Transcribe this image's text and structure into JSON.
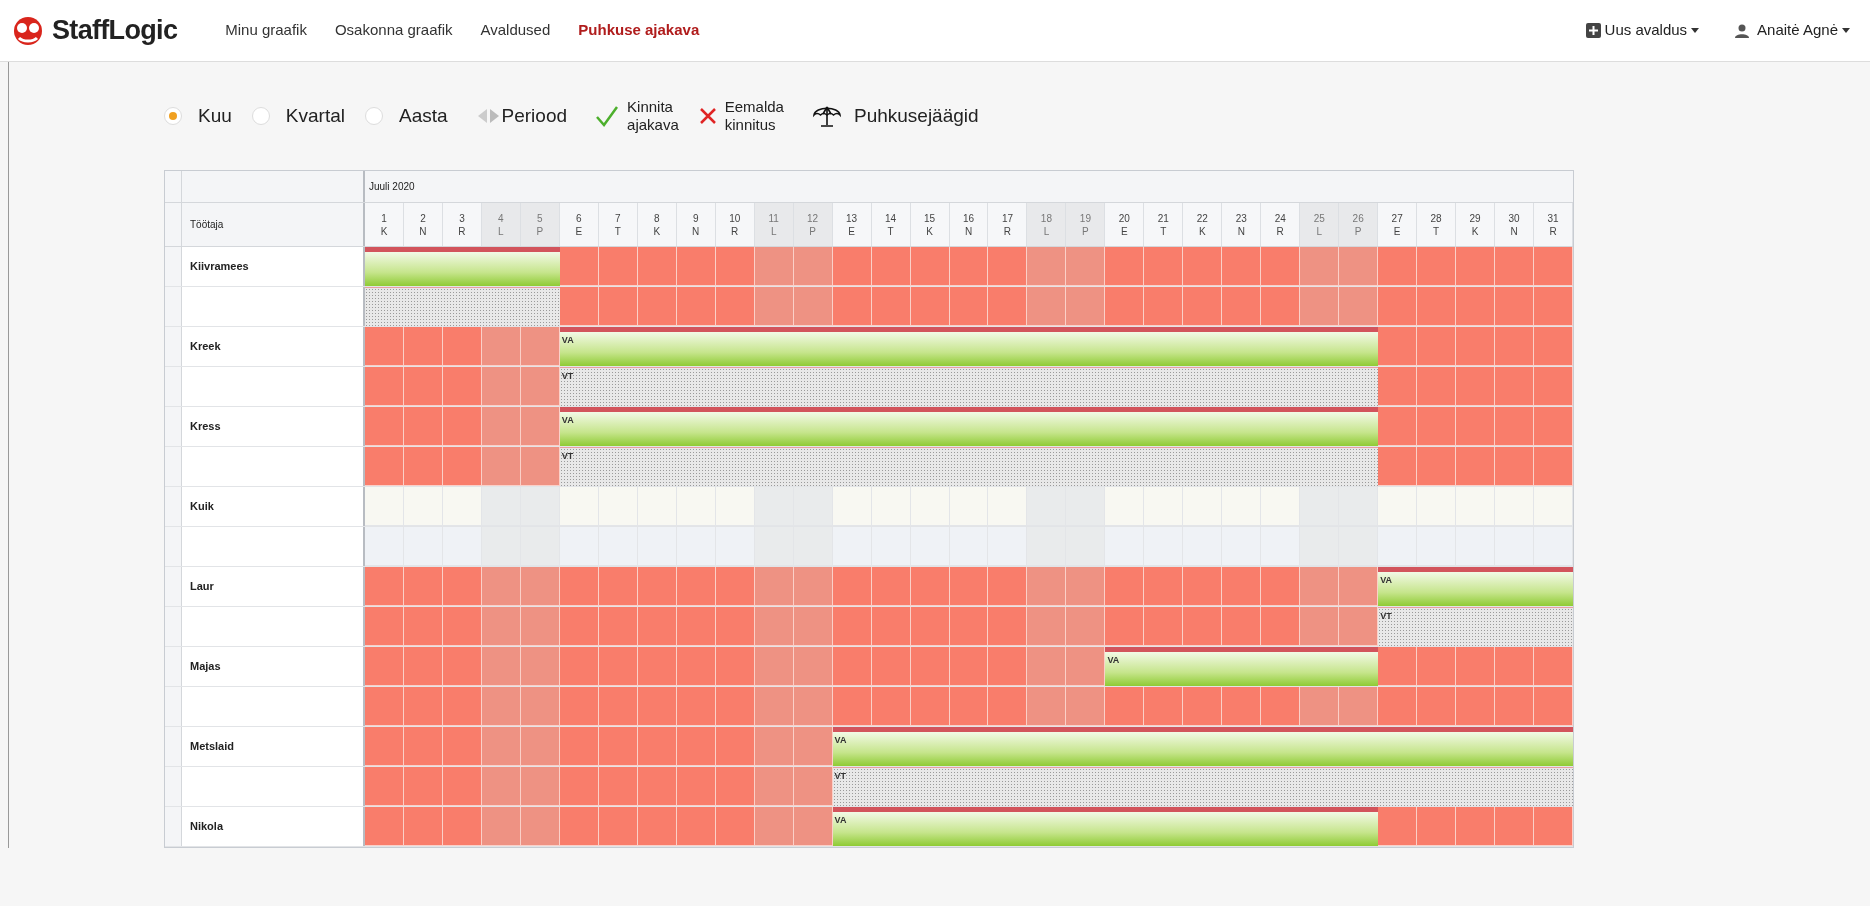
{
  "nav": {
    "brand": "StaffLogic",
    "links": [
      {
        "label": "Minu graafik",
        "selected": false
      },
      {
        "label": "Osakonna graafik",
        "selected": false
      },
      {
        "label": "Avaldused",
        "selected": false
      },
      {
        "label": "Puhkuse ajakava",
        "selected": true
      }
    ],
    "new_request": "Uus avaldus",
    "user": "Anaitė Agnė"
  },
  "toolbar": {
    "views": [
      {
        "label": "Kuu",
        "selected": true
      },
      {
        "label": "Kvartal",
        "selected": false
      },
      {
        "label": "Aasta",
        "selected": false
      }
    ],
    "period": "Periood",
    "confirm": [
      "Kinnita",
      "ajakava"
    ],
    "remove": [
      "Eemalda",
      "kinnitus"
    ],
    "balances": "Puhkusejäägid"
  },
  "table": {
    "month": "Juuli 2020",
    "name_header": "Töötaja",
    "days": [
      {
        "day": "1",
        "weekday": "K",
        "weekend": false
      },
      {
        "day": "2",
        "weekday": "N",
        "weekend": false
      },
      {
        "day": "3",
        "weekday": "R",
        "weekend": false
      },
      {
        "day": "4",
        "weekday": "L",
        "weekend": true
      },
      {
        "day": "5",
        "weekday": "P",
        "weekend": true
      },
      {
        "day": "6",
        "weekday": "E",
        "weekend": false
      },
      {
        "day": "7",
        "weekday": "T",
        "weekend": false
      },
      {
        "day": "8",
        "weekday": "K",
        "weekend": false
      },
      {
        "day": "9",
        "weekday": "N",
        "weekend": false
      },
      {
        "day": "10",
        "weekday": "R",
        "weekend": false
      },
      {
        "day": "11",
        "weekday": "L",
        "weekend": true
      },
      {
        "day": "12",
        "weekday": "P",
        "weekend": true
      },
      {
        "day": "13",
        "weekday": "E",
        "weekend": false
      },
      {
        "day": "14",
        "weekday": "T",
        "weekend": false
      },
      {
        "day": "15",
        "weekday": "K",
        "weekend": false
      },
      {
        "day": "16",
        "weekday": "N",
        "weekend": false
      },
      {
        "day": "17",
        "weekday": "R",
        "weekend": false
      },
      {
        "day": "18",
        "weekday": "L",
        "weekend": true
      },
      {
        "day": "19",
        "weekday": "P",
        "weekend": true
      },
      {
        "day": "20",
        "weekday": "E",
        "weekend": false
      },
      {
        "day": "21",
        "weekday": "T",
        "weekend": false
      },
      {
        "day": "22",
        "weekday": "K",
        "weekend": false
      },
      {
        "day": "23",
        "weekday": "N",
        "weekend": false
      },
      {
        "day": "24",
        "weekday": "R",
        "weekend": false
      },
      {
        "day": "25",
        "weekday": "L",
        "weekend": true
      },
      {
        "day": "26",
        "weekday": "P",
        "weekend": true
      },
      {
        "day": "27",
        "weekday": "E",
        "weekend": false
      },
      {
        "day": "28",
        "weekday": "T",
        "weekend": false
      },
      {
        "day": "29",
        "weekday": "K",
        "weekend": false
      },
      {
        "day": "30",
        "weekday": "N",
        "weekend": false
      },
      {
        "day": "31",
        "weekday": "R",
        "weekend": false
      }
    ],
    "employees": [
      {
        "name": "Kiivramees",
        "blocked": true,
        "rows": [
          {
            "cells": [
              {
                "kind": "vacation"
              },
              {
                "kind": "vacation"
              },
              {
                "kind": "vacation"
              },
              {
                "kind": "vacation"
              },
              {
                "kind": "vacation"
              },
              {
                "kind": "work"
              },
              {
                "kind": "work"
              },
              {
                "kind": "work"
              },
              {
                "kind": "work"
              },
              {
                "kind": "work"
              },
              {
                "kind": "work"
              },
              {
                "kind": "work"
              },
              {
                "kind": "work"
              },
              {
                "kind": "work"
              },
              {
                "kind": "work"
              },
              {
                "kind": "work"
              },
              {
                "kind": "work"
              },
              {
                "kind": "work"
              },
              {
                "kind": "work"
              },
              {
                "kind": "work"
              },
              {
                "kind": "work"
              },
              {
                "kind": "work"
              },
              {
                "kind": "work"
              },
              {
                "kind": "work"
              },
              {
                "kind": "work"
              },
              {
                "kind": "work"
              },
              {
                "kind": "work"
              },
              {
                "kind": "work"
              },
              {
                "kind": "work"
              },
              {
                "kind": "work"
              },
              {
                "kind": "work"
              }
            ]
          },
          {
            "cells": [
              {
                "kind": "planned"
              },
              {
                "kind": "planned"
              },
              {
                "kind": "planned"
              },
              {
                "kind": "planned"
              },
              {
                "kind": "planned"
              },
              {
                "kind": "work"
              },
              {
                "kind": "work"
              },
              {
                "kind": "work"
              },
              {
                "kind": "work"
              },
              {
                "kind": "work"
              },
              {
                "kind": "work"
              },
              {
                "kind": "work"
              },
              {
                "kind": "work"
              },
              {
                "kind": "work"
              },
              {
                "kind": "work"
              },
              {
                "kind": "work"
              },
              {
                "kind": "work"
              },
              {
                "kind": "work"
              },
              {
                "kind": "work"
              },
              {
                "kind": "work"
              },
              {
                "kind": "work"
              },
              {
                "kind": "work"
              },
              {
                "kind": "work"
              },
              {
                "kind": "work"
              },
              {
                "kind": "work"
              },
              {
                "kind": "work"
              },
              {
                "kind": "work"
              },
              {
                "kind": "work"
              },
              {
                "kind": "work"
              },
              {
                "kind": "work"
              },
              {
                "kind": "work"
              }
            ]
          }
        ]
      },
      {
        "name": "Kreek",
        "blocked": true,
        "rows": [
          {
            "label": "VA",
            "cells": [
              {
                "kind": "work"
              },
              {
                "kind": "work"
              },
              {
                "kind": "work"
              },
              {
                "kind": "work"
              },
              {
                "kind": "work"
              },
              {
                "kind": "vacation"
              },
              {
                "kind": "vacation"
              },
              {
                "kind": "vacation"
              },
              {
                "kind": "vacation"
              },
              {
                "kind": "vacation"
              },
              {
                "kind": "vacation"
              },
              {
                "kind": "vacation"
              },
              {
                "kind": "vacation"
              },
              {
                "kind": "vacation"
              },
              {
                "kind": "vacation"
              },
              {
                "kind": "vacation"
              },
              {
                "kind": "vacation"
              },
              {
                "kind": "vacation"
              },
              {
                "kind": "vacation"
              },
              {
                "kind": "vacation"
              },
              {
                "kind": "vacation"
              },
              {
                "kind": "vacation"
              },
              {
                "kind": "vacation"
              },
              {
                "kind": "vacation"
              },
              {
                "kind": "vacation"
              },
              {
                "kind": "vacation"
              },
              {
                "kind": "work"
              },
              {
                "kind": "work"
              },
              {
                "kind": "work"
              },
              {
                "kind": "work"
              },
              {
                "kind": "work"
              }
            ]
          },
          {
            "label": "VT",
            "cells": [
              {
                "kind": "work"
              },
              {
                "kind": "work"
              },
              {
                "kind": "work"
              },
              {
                "kind": "work"
              },
              {
                "kind": "work"
              },
              {
                "kind": "planned"
              },
              {
                "kind": "planned"
              },
              {
                "kind": "planned"
              },
              {
                "kind": "planned"
              },
              {
                "kind": "planned"
              },
              {
                "kind": "planned"
              },
              {
                "kind": "planned"
              },
              {
                "kind": "planned"
              },
              {
                "kind": "planned"
              },
              {
                "kind": "planned"
              },
              {
                "kind": "planned"
              },
              {
                "kind": "planned"
              },
              {
                "kind": "planned"
              },
              {
                "kind": "planned"
              },
              {
                "kind": "planned"
              },
              {
                "kind": "planned"
              },
              {
                "kind": "planned"
              },
              {
                "kind": "planned"
              },
              {
                "kind": "planned"
              },
              {
                "kind": "planned"
              },
              {
                "kind": "planned"
              },
              {
                "kind": "work"
              },
              {
                "kind": "work"
              },
              {
                "kind": "work"
              },
              {
                "kind": "work"
              },
              {
                "kind": "work"
              }
            ]
          }
        ]
      },
      {
        "name": "Kress",
        "blocked": true,
        "rows": [
          {
            "label": "VA",
            "cells": [
              {
                "kind": "work"
              },
              {
                "kind": "work"
              },
              {
                "kind": "work"
              },
              {
                "kind": "work"
              },
              {
                "kind": "work"
              },
              {
                "kind": "vacation"
              },
              {
                "kind": "vacation"
              },
              {
                "kind": "vacation"
              },
              {
                "kind": "vacation"
              },
              {
                "kind": "vacation"
              },
              {
                "kind": "vacation"
              },
              {
                "kind": "vacation"
              },
              {
                "kind": "vacation"
              },
              {
                "kind": "vacation"
              },
              {
                "kind": "vacation"
              },
              {
                "kind": "vacation"
              },
              {
                "kind": "vacation"
              },
              {
                "kind": "vacation"
              },
              {
                "kind": "vacation"
              },
              {
                "kind": "vacation"
              },
              {
                "kind": "vacation"
              },
              {
                "kind": "vacation"
              },
              {
                "kind": "vacation"
              },
              {
                "kind": "vacation"
              },
              {
                "kind": "vacation"
              },
              {
                "kind": "vacation"
              },
              {
                "kind": "work"
              },
              {
                "kind": "work"
              },
              {
                "kind": "work"
              },
              {
                "kind": "work"
              },
              {
                "kind": "work"
              }
            ]
          },
          {
            "label": "VT",
            "cells": [
              {
                "kind": "work"
              },
              {
                "kind": "work"
              },
              {
                "kind": "work"
              },
              {
                "kind": "work"
              },
              {
                "kind": "work"
              },
              {
                "kind": "planned"
              },
              {
                "kind": "planned"
              },
              {
                "kind": "planned"
              },
              {
                "kind": "planned"
              },
              {
                "kind": "planned"
              },
              {
                "kind": "planned"
              },
              {
                "kind": "planned"
              },
              {
                "kind": "planned"
              },
              {
                "kind": "planned"
              },
              {
                "kind": "planned"
              },
              {
                "kind": "planned"
              },
              {
                "kind": "planned"
              },
              {
                "kind": "planned"
              },
              {
                "kind": "planned"
              },
              {
                "kind": "planned"
              },
              {
                "kind": "planned"
              },
              {
                "kind": "planned"
              },
              {
                "kind": "planned"
              },
              {
                "kind": "planned"
              },
              {
                "kind": "planned"
              },
              {
                "kind": "planned"
              },
              {
                "kind": "work"
              },
              {
                "kind": "work"
              },
              {
                "kind": "work"
              },
              {
                "kind": "work"
              },
              {
                "kind": "work"
              }
            ]
          }
        ]
      },
      {
        "name": "Kuik",
        "blocked": false,
        "rows": [
          {
            "cells": [
              {
                "kind": "work"
              },
              {
                "kind": "work"
              },
              {
                "kind": "work"
              },
              {
                "kind": "work"
              },
              {
                "kind": "work"
              },
              {
                "kind": "work"
              },
              {
                "kind": "work"
              },
              {
                "kind": "work"
              },
              {
                "kind": "work"
              },
              {
                "kind": "work"
              },
              {
                "kind": "work"
              },
              {
                "kind": "work"
              },
              {
                "kind": "work"
              },
              {
                "kind": "work"
              },
              {
                "kind": "work"
              },
              {
                "kind": "work"
              },
              {
                "kind": "work"
              },
              {
                "kind": "work"
              },
              {
                "kind": "work"
              },
              {
                "kind": "work"
              },
              {
                "kind": "work"
              },
              {
                "kind": "work"
              },
              {
                "kind": "work"
              },
              {
                "kind": "work"
              },
              {
                "kind": "work"
              },
              {
                "kind": "work"
              },
              {
                "kind": "work"
              },
              {
                "kind": "work"
              },
              {
                "kind": "work"
              },
              {
                "kind": "work"
              },
              {
                "kind": "work"
              }
            ]
          },
          {
            "cells": [
              {
                "kind": "work"
              },
              {
                "kind": "work"
              },
              {
                "kind": "work"
              },
              {
                "kind": "work"
              },
              {
                "kind": "work"
              },
              {
                "kind": "work"
              },
              {
                "kind": "work"
              },
              {
                "kind": "work"
              },
              {
                "kind": "work"
              },
              {
                "kind": "work"
              },
              {
                "kind": "work"
              },
              {
                "kind": "work"
              },
              {
                "kind": "work"
              },
              {
                "kind": "work"
              },
              {
                "kind": "work"
              },
              {
                "kind": "work"
              },
              {
                "kind": "work"
              },
              {
                "kind": "work"
              },
              {
                "kind": "work"
              },
              {
                "kind": "work"
              },
              {
                "kind": "work"
              },
              {
                "kind": "work"
              },
              {
                "kind": "work"
              },
              {
                "kind": "work"
              },
              {
                "kind": "work"
              },
              {
                "kind": "work"
              },
              {
                "kind": "work"
              },
              {
                "kind": "work"
              },
              {
                "kind": "work"
              },
              {
                "kind": "work"
              },
              {
                "kind": "work"
              }
            ]
          }
        ]
      },
      {
        "name": "Laur",
        "blocked": true,
        "rows": [
          {
            "label": "VA",
            "cells": [
              {
                "kind": "work"
              },
              {
                "kind": "work"
              },
              {
                "kind": "work"
              },
              {
                "kind": "work"
              },
              {
                "kind": "work"
              },
              {
                "kind": "work"
              },
              {
                "kind": "work"
              },
              {
                "kind": "work"
              },
              {
                "kind": "work"
              },
              {
                "kind": "work"
              },
              {
                "kind": "work"
              },
              {
                "kind": "work"
              },
              {
                "kind": "work"
              },
              {
                "kind": "work"
              },
              {
                "kind": "work"
              },
              {
                "kind": "work"
              },
              {
                "kind": "work"
              },
              {
                "kind": "work"
              },
              {
                "kind": "work"
              },
              {
                "kind": "work"
              },
              {
                "kind": "work"
              },
              {
                "kind": "work"
              },
              {
                "kind": "work"
              },
              {
                "kind": "work"
              },
              {
                "kind": "work"
              },
              {
                "kind": "work"
              },
              {
                "kind": "vacation"
              },
              {
                "kind": "vacation"
              },
              {
                "kind": "vacation"
              },
              {
                "kind": "vacation"
              },
              {
                "kind": "vacation"
              }
            ]
          },
          {
            "label": "VT",
            "cells": [
              {
                "kind": "work"
              },
              {
                "kind": "work"
              },
              {
                "kind": "work"
              },
              {
                "kind": "work"
              },
              {
                "kind": "work"
              },
              {
                "kind": "work"
              },
              {
                "kind": "work"
              },
              {
                "kind": "work"
              },
              {
                "kind": "work"
              },
              {
                "kind": "work"
              },
              {
                "kind": "work"
              },
              {
                "kind": "work"
              },
              {
                "kind": "work"
              },
              {
                "kind": "work"
              },
              {
                "kind": "work"
              },
              {
                "kind": "work"
              },
              {
                "kind": "work"
              },
              {
                "kind": "work"
              },
              {
                "kind": "work"
              },
              {
                "kind": "work"
              },
              {
                "kind": "work"
              },
              {
                "kind": "work"
              },
              {
                "kind": "work"
              },
              {
                "kind": "work"
              },
              {
                "kind": "work"
              },
              {
                "kind": "work"
              },
              {
                "kind": "planned"
              },
              {
                "kind": "planned"
              },
              {
                "kind": "planned"
              },
              {
                "kind": "planned"
              },
              {
                "kind": "planned"
              }
            ]
          }
        ]
      },
      {
        "name": "Majas",
        "blocked": true,
        "rows": [
          {
            "label": "VA",
            "cells": [
              {
                "kind": "work"
              },
              {
                "kind": "work"
              },
              {
                "kind": "work"
              },
              {
                "kind": "work"
              },
              {
                "kind": "work"
              },
              {
                "kind": "work"
              },
              {
                "kind": "work"
              },
              {
                "kind": "work"
              },
              {
                "kind": "work"
              },
              {
                "kind": "work"
              },
              {
                "kind": "work"
              },
              {
                "kind": "work"
              },
              {
                "kind": "work"
              },
              {
                "kind": "work"
              },
              {
                "kind": "work"
              },
              {
                "kind": "work"
              },
              {
                "kind": "work"
              },
              {
                "kind": "work"
              },
              {
                "kind": "work"
              },
              {
                "kind": "vacation"
              },
              {
                "kind": "vacation"
              },
              {
                "kind": "vacation"
              },
              {
                "kind": "vacation"
              },
              {
                "kind": "vacation"
              },
              {
                "kind": "vacation"
              },
              {
                "kind": "vacation"
              },
              {
                "kind": "work"
              },
              {
                "kind": "work"
              },
              {
                "kind": "work"
              },
              {
                "kind": "work"
              },
              {
                "kind": "work"
              }
            ]
          },
          {
            "cells": [
              {
                "kind": "work"
              },
              {
                "kind": "work"
              },
              {
                "kind": "work"
              },
              {
                "kind": "work"
              },
              {
                "kind": "work"
              },
              {
                "kind": "work"
              },
              {
                "kind": "work"
              },
              {
                "kind": "work"
              },
              {
                "kind": "work"
              },
              {
                "kind": "work"
              },
              {
                "kind": "work"
              },
              {
                "kind": "work"
              },
              {
                "kind": "work"
              },
              {
                "kind": "work"
              },
              {
                "kind": "work"
              },
              {
                "kind": "work"
              },
              {
                "kind": "work"
              },
              {
                "kind": "work"
              },
              {
                "kind": "work"
              },
              {
                "kind": "work"
              },
              {
                "kind": "work"
              },
              {
                "kind": "work"
              },
              {
                "kind": "work"
              },
              {
                "kind": "work"
              },
              {
                "kind": "work"
              },
              {
                "kind": "work"
              },
              {
                "kind": "work"
              },
              {
                "kind": "work"
              },
              {
                "kind": "work"
              },
              {
                "kind": "work"
              },
              {
                "kind": "work"
              }
            ]
          }
        ]
      },
      {
        "name": "Metslaid",
        "blocked": true,
        "rows": [
          {
            "label": "VA",
            "cells": [
              {
                "kind": "work"
              },
              {
                "kind": "work"
              },
              {
                "kind": "work"
              },
              {
                "kind": "work"
              },
              {
                "kind": "work"
              },
              {
                "kind": "work"
              },
              {
                "kind": "work"
              },
              {
                "kind": "work"
              },
              {
                "kind": "work"
              },
              {
                "kind": "work"
              },
              {
                "kind": "work"
              },
              {
                "kind": "work"
              },
              {
                "kind": "vacation"
              },
              {
                "kind": "vacation"
              },
              {
                "kind": "vacation"
              },
              {
                "kind": "vacation"
              },
              {
                "kind": "vacation"
              },
              {
                "kind": "vacation"
              },
              {
                "kind": "vacation"
              },
              {
                "kind": "vacation"
              },
              {
                "kind": "vacation"
              },
              {
                "kind": "vacation"
              },
              {
                "kind": "vacation"
              },
              {
                "kind": "vacation"
              },
              {
                "kind": "vacation"
              },
              {
                "kind": "vacation"
              },
              {
                "kind": "vacation"
              },
              {
                "kind": "vacation"
              },
              {
                "kind": "vacation"
              },
              {
                "kind": "vacation"
              },
              {
                "kind": "vacation"
              }
            ]
          },
          {
            "label": "VT",
            "cells": [
              {
                "kind": "work"
              },
              {
                "kind": "work"
              },
              {
                "kind": "work"
              },
              {
                "kind": "work"
              },
              {
                "kind": "work"
              },
              {
                "kind": "work"
              },
              {
                "kind": "work"
              },
              {
                "kind": "work"
              },
              {
                "kind": "work"
              },
              {
                "kind": "work"
              },
              {
                "kind": "work"
              },
              {
                "kind": "work"
              },
              {
                "kind": "planned"
              },
              {
                "kind": "planned"
              },
              {
                "kind": "planned"
              },
              {
                "kind": "planned"
              },
              {
                "kind": "planned"
              },
              {
                "kind": "planned"
              },
              {
                "kind": "planned"
              },
              {
                "kind": "planned"
              },
              {
                "kind": "planned"
              },
              {
                "kind": "planned"
              },
              {
                "kind": "planned"
              },
              {
                "kind": "planned"
              },
              {
                "kind": "planned"
              },
              {
                "kind": "planned"
              },
              {
                "kind": "planned"
              },
              {
                "kind": "planned"
              },
              {
                "kind": "planned"
              },
              {
                "kind": "planned"
              },
              {
                "kind": "planned"
              }
            ]
          }
        ]
      },
      {
        "name": "Nikola",
        "blocked": true,
        "rows": [
          {
            "label": "VA",
            "cells": [
              {
                "kind": "work"
              },
              {
                "kind": "work"
              },
              {
                "kind": "work"
              },
              {
                "kind": "work"
              },
              {
                "kind": "work"
              },
              {
                "kind": "work"
              },
              {
                "kind": "work"
              },
              {
                "kind": "work"
              },
              {
                "kind": "work"
              },
              {
                "kind": "work"
              },
              {
                "kind": "work"
              },
              {
                "kind": "work"
              },
              {
                "kind": "vacation"
              },
              {
                "kind": "vacation"
              },
              {
                "kind": "vacation"
              },
              {
                "kind": "vacation"
              },
              {
                "kind": "vacation"
              },
              {
                "kind": "vacation"
              },
              {
                "kind": "vacation"
              },
              {
                "kind": "vacation"
              },
              {
                "kind": "vacation"
              },
              {
                "kind": "vacation"
              },
              {
                "kind": "vacation"
              },
              {
                "kind": "vacation"
              },
              {
                "kind": "vacation"
              },
              {
                "kind": "vacation"
              },
              {
                "kind": "work"
              },
              {
                "kind": "work"
              },
              {
                "kind": "work"
              },
              {
                "kind": "work"
              },
              {
                "kind": "work"
              }
            ]
          }
        ]
      }
    ]
  }
}
